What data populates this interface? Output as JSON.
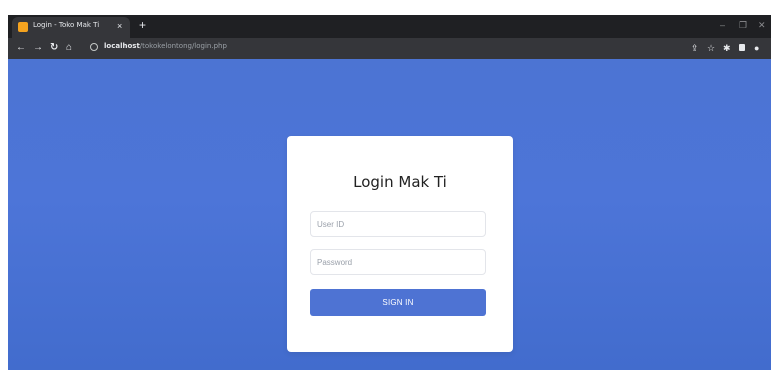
{
  "browser": {
    "tab_title": "Login - Toko Mak Ti",
    "tab_close": "×",
    "new_tab": "+",
    "window_controls": {
      "minimize": "–",
      "restore": "❐",
      "close": "✕"
    },
    "url_host": "localhost",
    "url_path": "/tokokelontong/login.php",
    "icons": {
      "back": "back-arrow-icon",
      "forward": "forward-arrow-icon",
      "reload": "reload-icon",
      "home": "home-icon",
      "site_info": "info-icon",
      "share": "share-icon",
      "bookmark": "star-icon",
      "extensions": "puzzle-icon",
      "sidepanel": "sidepanel-icon",
      "profile": "profile-icon"
    }
  },
  "page": {
    "background_color": "#4d75d8",
    "accent_color": "#4e73d3"
  },
  "login": {
    "title": "Login Mak Ti",
    "userid_placeholder": "User ID",
    "password_placeholder": "Password",
    "signin_label": "SIGN IN"
  }
}
